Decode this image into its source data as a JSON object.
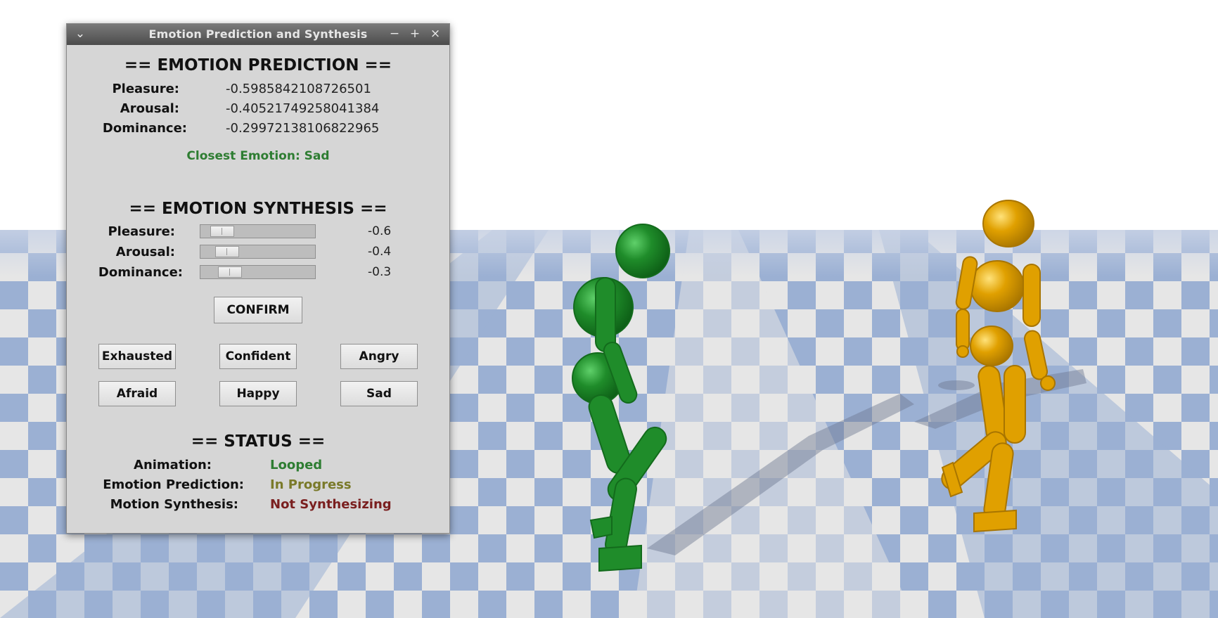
{
  "window": {
    "title": "Emotion Prediction and Synthesis",
    "menu_glyph": "⌄",
    "minimize_glyph": "−",
    "maximize_glyph": "+",
    "close_glyph": "×"
  },
  "prediction": {
    "heading": "== EMOTION PREDICTION ==",
    "pleasure_label": "Pleasure:",
    "pleasure_value": "-0.5985842108726501",
    "arousal_label": "Arousal:",
    "arousal_value": "-0.40521749258041384",
    "dominance_label": "Dominance:",
    "dominance_value": "-0.29972138106822965",
    "closest": "Closest Emotion: Sad"
  },
  "synthesis": {
    "heading": "== EMOTION SYNTHESIS ==",
    "pleasure_label": "Pleasure:",
    "pleasure_value": "-0.6",
    "arousal_label": "Arousal:",
    "arousal_value": "-0.4",
    "dominance_label": "Dominance:",
    "dominance_value": "-0.3",
    "slider_range": [
      -1,
      1
    ],
    "confirm_label": "CONFIRM",
    "presets": [
      "Exhausted",
      "Confident",
      "Angry",
      "Afraid",
      "Happy",
      "Sad"
    ]
  },
  "status": {
    "heading": "== STATUS ==",
    "animation_label": "Animation:",
    "animation_value": "Looped",
    "prediction_label": "Emotion Prediction:",
    "prediction_value": "In Progress",
    "synthesis_label": "Motion Synthesis:",
    "synthesis_value": "Not Synthesizing"
  },
  "colors": {
    "floor_blue": "#9bb0d3",
    "floor_white": "#e6e6e6",
    "green_character": "#1f8c2a",
    "orange_character": "#e0a000",
    "status_green": "#2e7d32",
    "status_olive": "#7a7a2a",
    "status_maroon": "#7a1f1f"
  }
}
